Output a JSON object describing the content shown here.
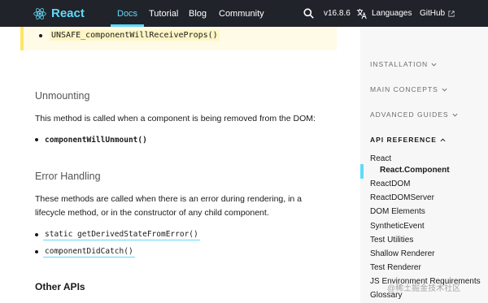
{
  "nav": {
    "brand": "React",
    "links": [
      "Docs",
      "Tutorial",
      "Blog",
      "Community"
    ],
    "version": "v16.8.6",
    "languages": "Languages",
    "github": "GitHub"
  },
  "main": {
    "note_item": "UNSAFE_componentWillReceiveProps()",
    "unmounting": {
      "heading": "Unmounting",
      "text": "This method is called when a component is being removed from the DOM:",
      "item": "componentWillUnmount()"
    },
    "error_handling": {
      "heading": "Error Handling",
      "text": "These methods are called when there is an error during rendering, in a lifecycle method, or in the constructor of any child component.",
      "items": [
        "static getDerivedStateFromError()",
        "componentDidCatch()"
      ]
    },
    "other_apis": "Other APIs"
  },
  "sidebar": {
    "sections": [
      "INSTALLATION",
      "MAIN CONCEPTS",
      "ADVANCED GUIDES",
      "API REFERENCE"
    ],
    "items": [
      "React",
      "React.Component",
      "ReactDOM",
      "ReactDOMServer",
      "DOM Elements",
      "SyntheticEvent",
      "Test Utilities",
      "Shallow Renderer",
      "Test Renderer",
      "JS Environment Requirements",
      "Glossary"
    ]
  },
  "watermark": "@稀土掘金技术社区",
  "colors": {
    "nav_bg": "#20232a",
    "accent": "#61dafb",
    "note_bg": "#fffbe6",
    "note_border": "#ffe564",
    "sidebar_bg": "#f7f7f7"
  }
}
